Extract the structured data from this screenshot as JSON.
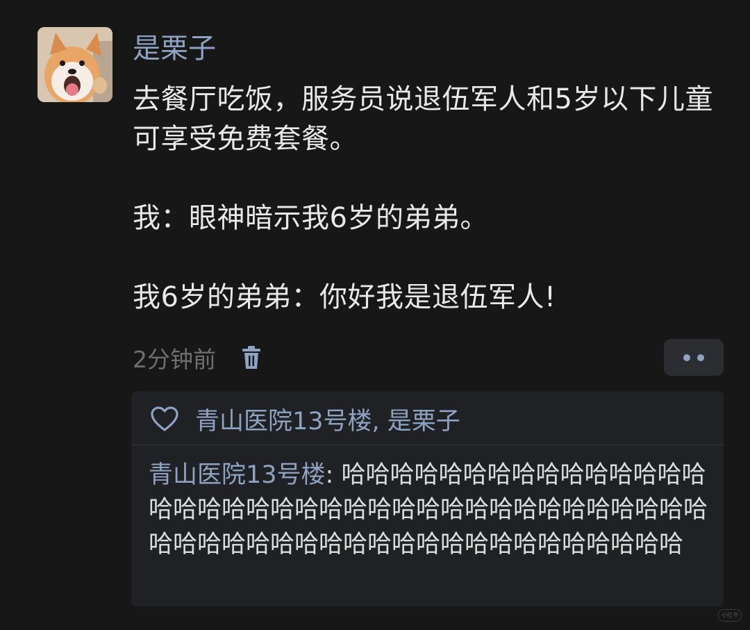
{
  "post": {
    "author": "是栗子",
    "avatar_icon": "shiba-dog-avatar",
    "text_line_1": "去餐厅吃饭，服务员说退伍军人和5岁以下儿童可享受免费套餐。",
    "text_line_2": "我：眼神暗示我6岁的弟弟。",
    "text_line_3": "我6岁的弟弟：你好我是退伍军人!",
    "timestamp": "2分钟前",
    "delete_icon": "trash-icon",
    "more_icon": "more-dots-icon"
  },
  "likes": {
    "icon": "heart-icon",
    "names": "青山医院13号楼, 是栗子"
  },
  "reply": {
    "user": "青山医院13号楼",
    "separator": ": ",
    "text": "哈哈哈哈哈哈哈哈哈哈哈哈哈哈哈哈哈哈哈哈哈哈哈哈哈哈哈哈哈哈哈哈哈哈哈哈哈哈哈哈哈哈哈哈哈哈哈哈哈哈哈哈哈哈哈哈哈哈哈哈"
  },
  "colors": {
    "background": "#171717",
    "accent": "#8ea2c2",
    "text": "#e9e9e9",
    "muted": "#6f6f6f",
    "panel": "#202124"
  }
}
